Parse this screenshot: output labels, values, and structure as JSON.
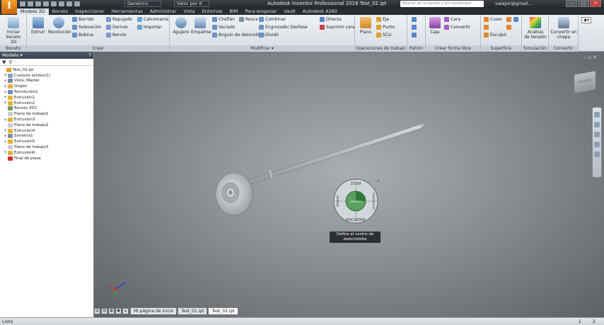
{
  "titlebar": {
    "app_icon": "I",
    "material": "Genérico",
    "appearance": "Valor por d",
    "title": "Autodesk Inventor Professional 2016   Test_02.ipt",
    "search_placeholder": "Buscar en la ayuda y los comandos",
    "user": "valajor@gmail..."
  },
  "ribbon_tabs": [
    "Modelo 3D",
    "Boceto",
    "Inspeccionar",
    "Herramientas",
    "Administrar",
    "Vista",
    "Entornos",
    "BIM",
    "Para empezar",
    "Vault",
    "Autodesk A360"
  ],
  "ribbon": {
    "boceto": {
      "title": "Boceto",
      "iniciar_line1": "Iniciar",
      "iniciar_line2": "boceto 2D"
    },
    "crear": {
      "title": "Crear",
      "extruir": "Extruir",
      "revolucion": "Revolución",
      "barrido": "Barrido",
      "solevacion": "Solevación",
      "bobina": "Bobina",
      "repujado": "Repujado",
      "derivar": "Derivar",
      "nervio": "Nervio",
      "calcomania": "Calcomanía",
      "importar": "Importar"
    },
    "modificar": {
      "title": "Modificar ▾",
      "agujero": "Agujero",
      "empalme": "Empalme",
      "chaflan": "Chaflán",
      "vaciado": "Vaciado",
      "angulo": "Ángulo de desmoldeo",
      "rosca": "Rosca",
      "combinar": "Combinar",
      "engrosado": "Engrosado/ Desfase",
      "dividir": "Dividir",
      "directa": "Directa",
      "suprimir": "Suprimir cara"
    },
    "operaciones": {
      "title": "Operaciones de trabajo",
      "plano": "Plano",
      "eje": "Eje",
      "punto": "Punto",
      "scu": "SCU"
    },
    "patron": {
      "title": "Patrón"
    },
    "forma_libre": {
      "title": "Crear forma libre",
      "caja": "Caja",
      "cara": "Cara",
      "convertir": "Convertir"
    },
    "superficie": {
      "title": "Superficie",
      "coser": "Coser",
      "esculpir": "Esculpir"
    },
    "simulacion": {
      "title": "Simulación",
      "analisis_line1": "Análisis",
      "analisis_line2": "de tensión"
    },
    "convertir": {
      "title": "Convertir",
      "convertir_line1": "Convertir en",
      "convertir_line2": "chapa"
    }
  },
  "browser": {
    "title": "Modelo ▾",
    "items": [
      {
        "label": "Test_02.ipt",
        "color": "#e8a020",
        "indent": 0,
        "expander": ""
      },
      {
        "label": "Cuerpos sólidos(1)",
        "color": "#8aa0c0",
        "indent": 1,
        "expander": "+"
      },
      {
        "label": "Vista: Master",
        "color": "#7c8a9a",
        "indent": 1,
        "expander": "+"
      },
      {
        "label": "Origen",
        "color": "#e8b040",
        "indent": 1,
        "expander": "+"
      },
      {
        "label": "Revolución1",
        "color": "#6a90c8",
        "indent": 1,
        "expander": "+"
      },
      {
        "label": "Extrusión1",
        "color": "#e8b030",
        "indent": 1,
        "expander": "+"
      },
      {
        "label": "Extrusión2",
        "color": "#e8b030",
        "indent": 1,
        "expander": "+"
      },
      {
        "label": "Boceto 3D1",
        "color": "#70a060",
        "indent": 1,
        "expander": ""
      },
      {
        "label": "Plano de trabajo1",
        "color": "#c8ccd0",
        "indent": 1,
        "expander": ""
      },
      {
        "label": "Extrusión3",
        "color": "#e8b030",
        "indent": 1,
        "expander": "+"
      },
      {
        "label": "Plano de trabajo2",
        "color": "#c8ccd0",
        "indent": 1,
        "expander": ""
      },
      {
        "label": "Extrusión4",
        "color": "#e8b030",
        "indent": 1,
        "expander": "+"
      },
      {
        "label": "Simetría1",
        "color": "#8090a0",
        "indent": 1,
        "expander": "+"
      },
      {
        "label": "Extrusión5",
        "color": "#e8b030",
        "indent": 1,
        "expander": "+"
      },
      {
        "label": "Plano de trabajo3",
        "color": "#c8ccd0",
        "indent": 1,
        "expander": ""
      },
      {
        "label": "Extrusión6",
        "color": "#e8b030",
        "indent": 1,
        "expander": "+"
      },
      {
        "label": "Final de pieza",
        "color": "#d03030",
        "indent": 1,
        "expander": ""
      }
    ]
  },
  "viewport": {
    "viewcube_label": "FRONTAL",
    "wheel": {
      "zoom": "ZOOM",
      "orbita": "ÓRBITA",
      "encuadre": "ENCUADRE",
      "rebobinar": "REBOBINAR",
      "centro": "CENTRO"
    },
    "tooltip_line1": "Define el centro de",
    "tooltip_line2": "zoom/órbita"
  },
  "doctabs": [
    "Mi página de inicio",
    "Test_01.ipt",
    "Test_02.ipt"
  ],
  "statusbar": {
    "text": "Listo",
    "num1": "1",
    "num2": "2"
  }
}
